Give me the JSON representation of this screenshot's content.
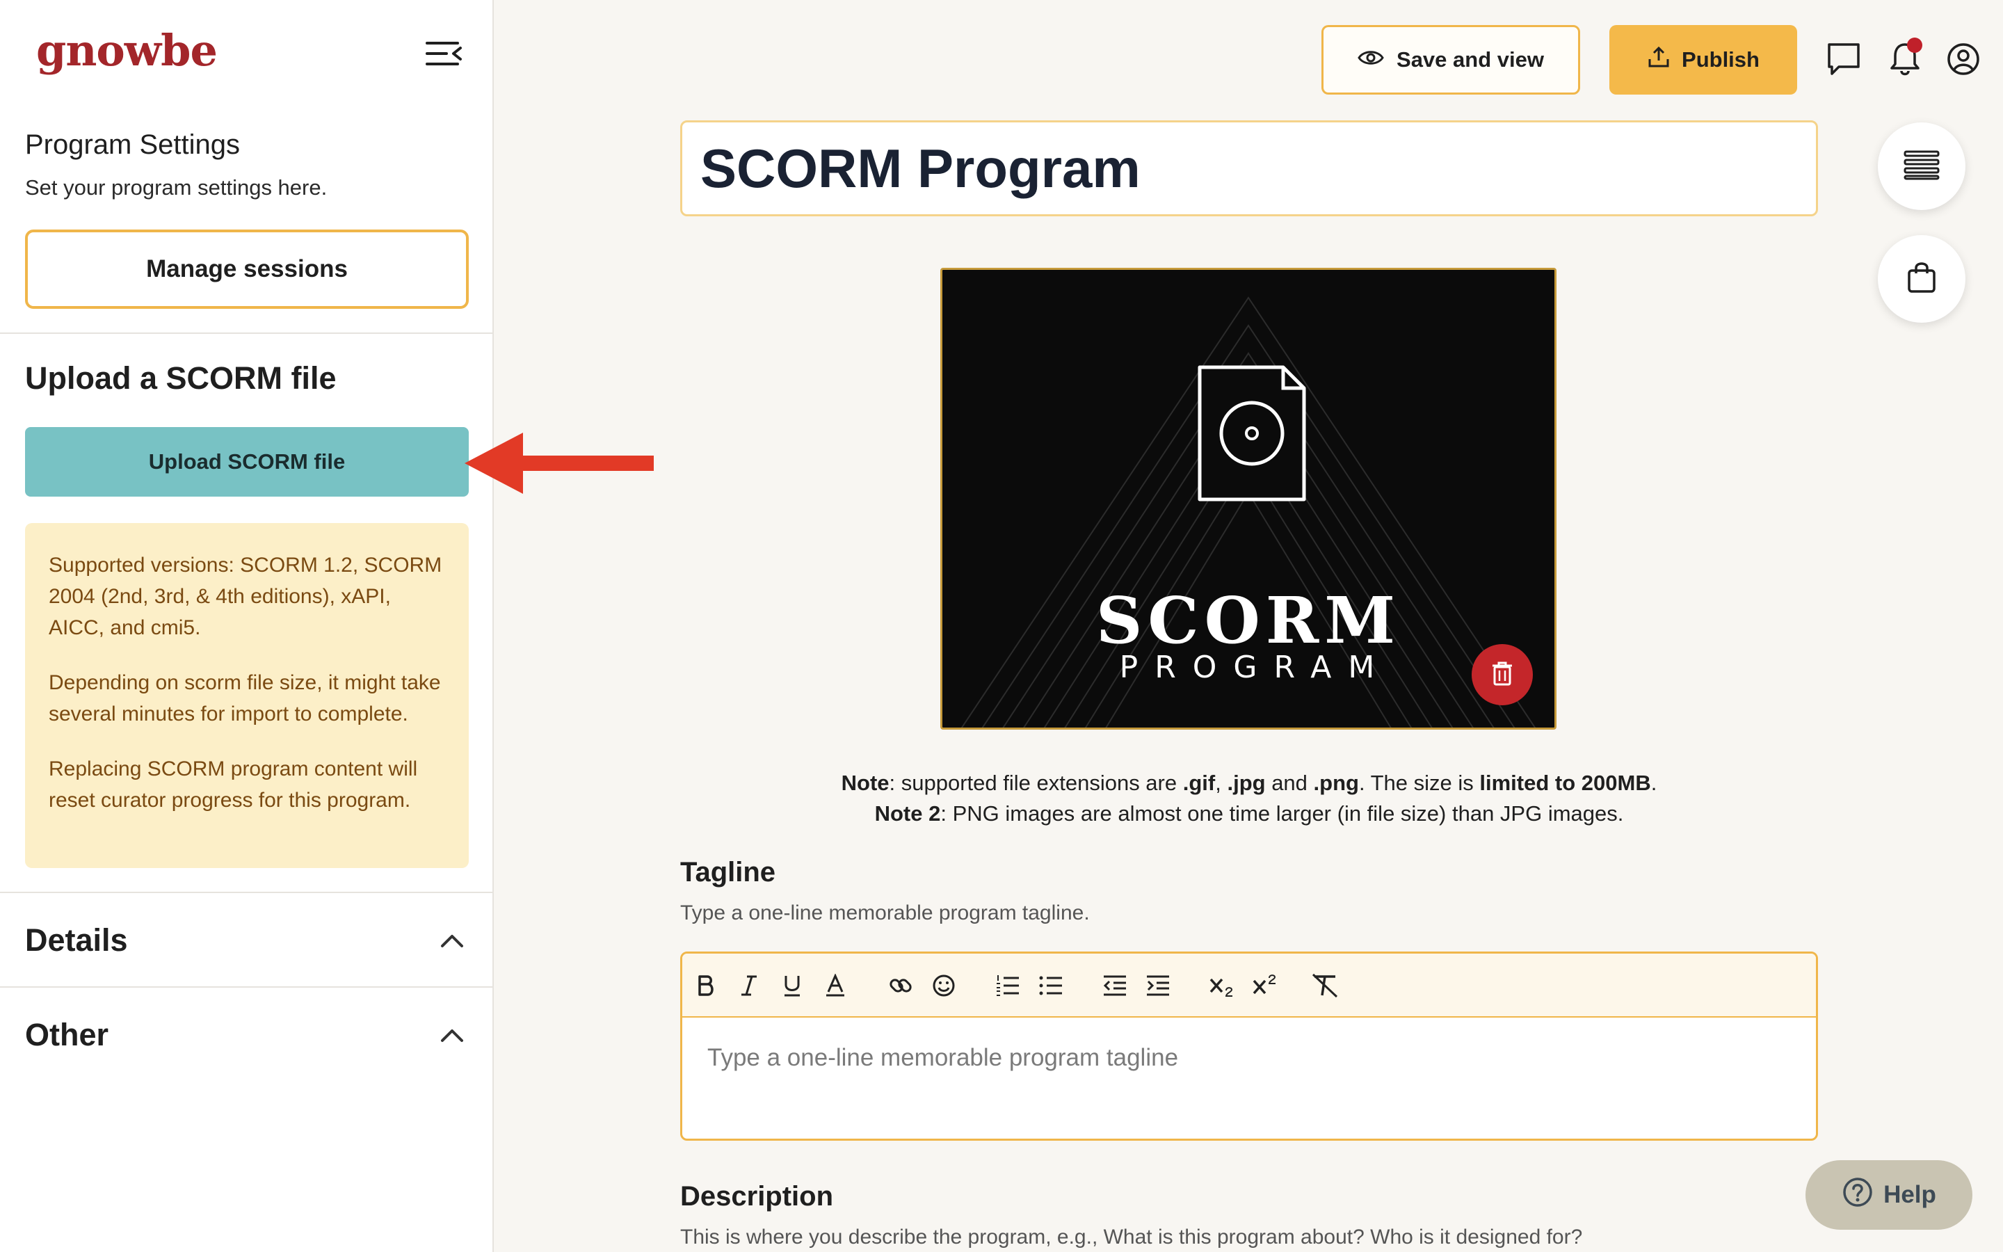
{
  "sidebar": {
    "logo": "gnowbe",
    "program_settings_title": "Program Settings",
    "program_settings_subtitle": "Set your program settings here.",
    "manage_sessions_label": "Manage sessions",
    "upload_section_title": "Upload a SCORM file",
    "upload_button_label": "Upload SCORM file",
    "notice": {
      "p1": "Supported versions: SCORM 1.2, SCORM 2004 (2nd, 3rd, & 4th editions), xAPI, AICC, and cmi5.",
      "p2": "Depending on scorm file size, it might take several minutes for import to complete.",
      "p3": "Replacing SCORM program content will reset curator progress for this program."
    },
    "details_label": "Details",
    "other_label": "Other"
  },
  "header": {
    "save_and_view_label": "Save and view",
    "publish_label": "Publish"
  },
  "program": {
    "title": "SCORM Program",
    "cover_word_1": "SCORM",
    "cover_word_2": "PROGRAM"
  },
  "notes": {
    "n1_label": "Note",
    "n1_text_a": ": supported file extensions are ",
    "n1_ext1": ".gif",
    "n1_sep1": ", ",
    "n1_ext2": ".jpg",
    "n1_sep2": " and ",
    "n1_ext3": ".png",
    "n1_text_b": ". The size is ",
    "n1_limit": "limited to 200MB",
    "n1_end": ".",
    "n2_label": "Note 2",
    "n2_text": ": PNG images are almost one time larger (in file size) than JPG images."
  },
  "tagline": {
    "title": "Tagline",
    "subtitle": "Type a one-line memorable program tagline.",
    "placeholder": "Type a one-line memorable program tagline"
  },
  "description": {
    "title": "Description",
    "subtitle": "This is where you describe the program, e.g., What is this program about? Who is it designed for?"
  },
  "help_label": "Help",
  "colors": {
    "accent": "#f0b64a",
    "brand": "#a3262a",
    "upload_button": "#78c2c4",
    "notice_bg": "#fcefc8",
    "delete": "#c4262a"
  }
}
